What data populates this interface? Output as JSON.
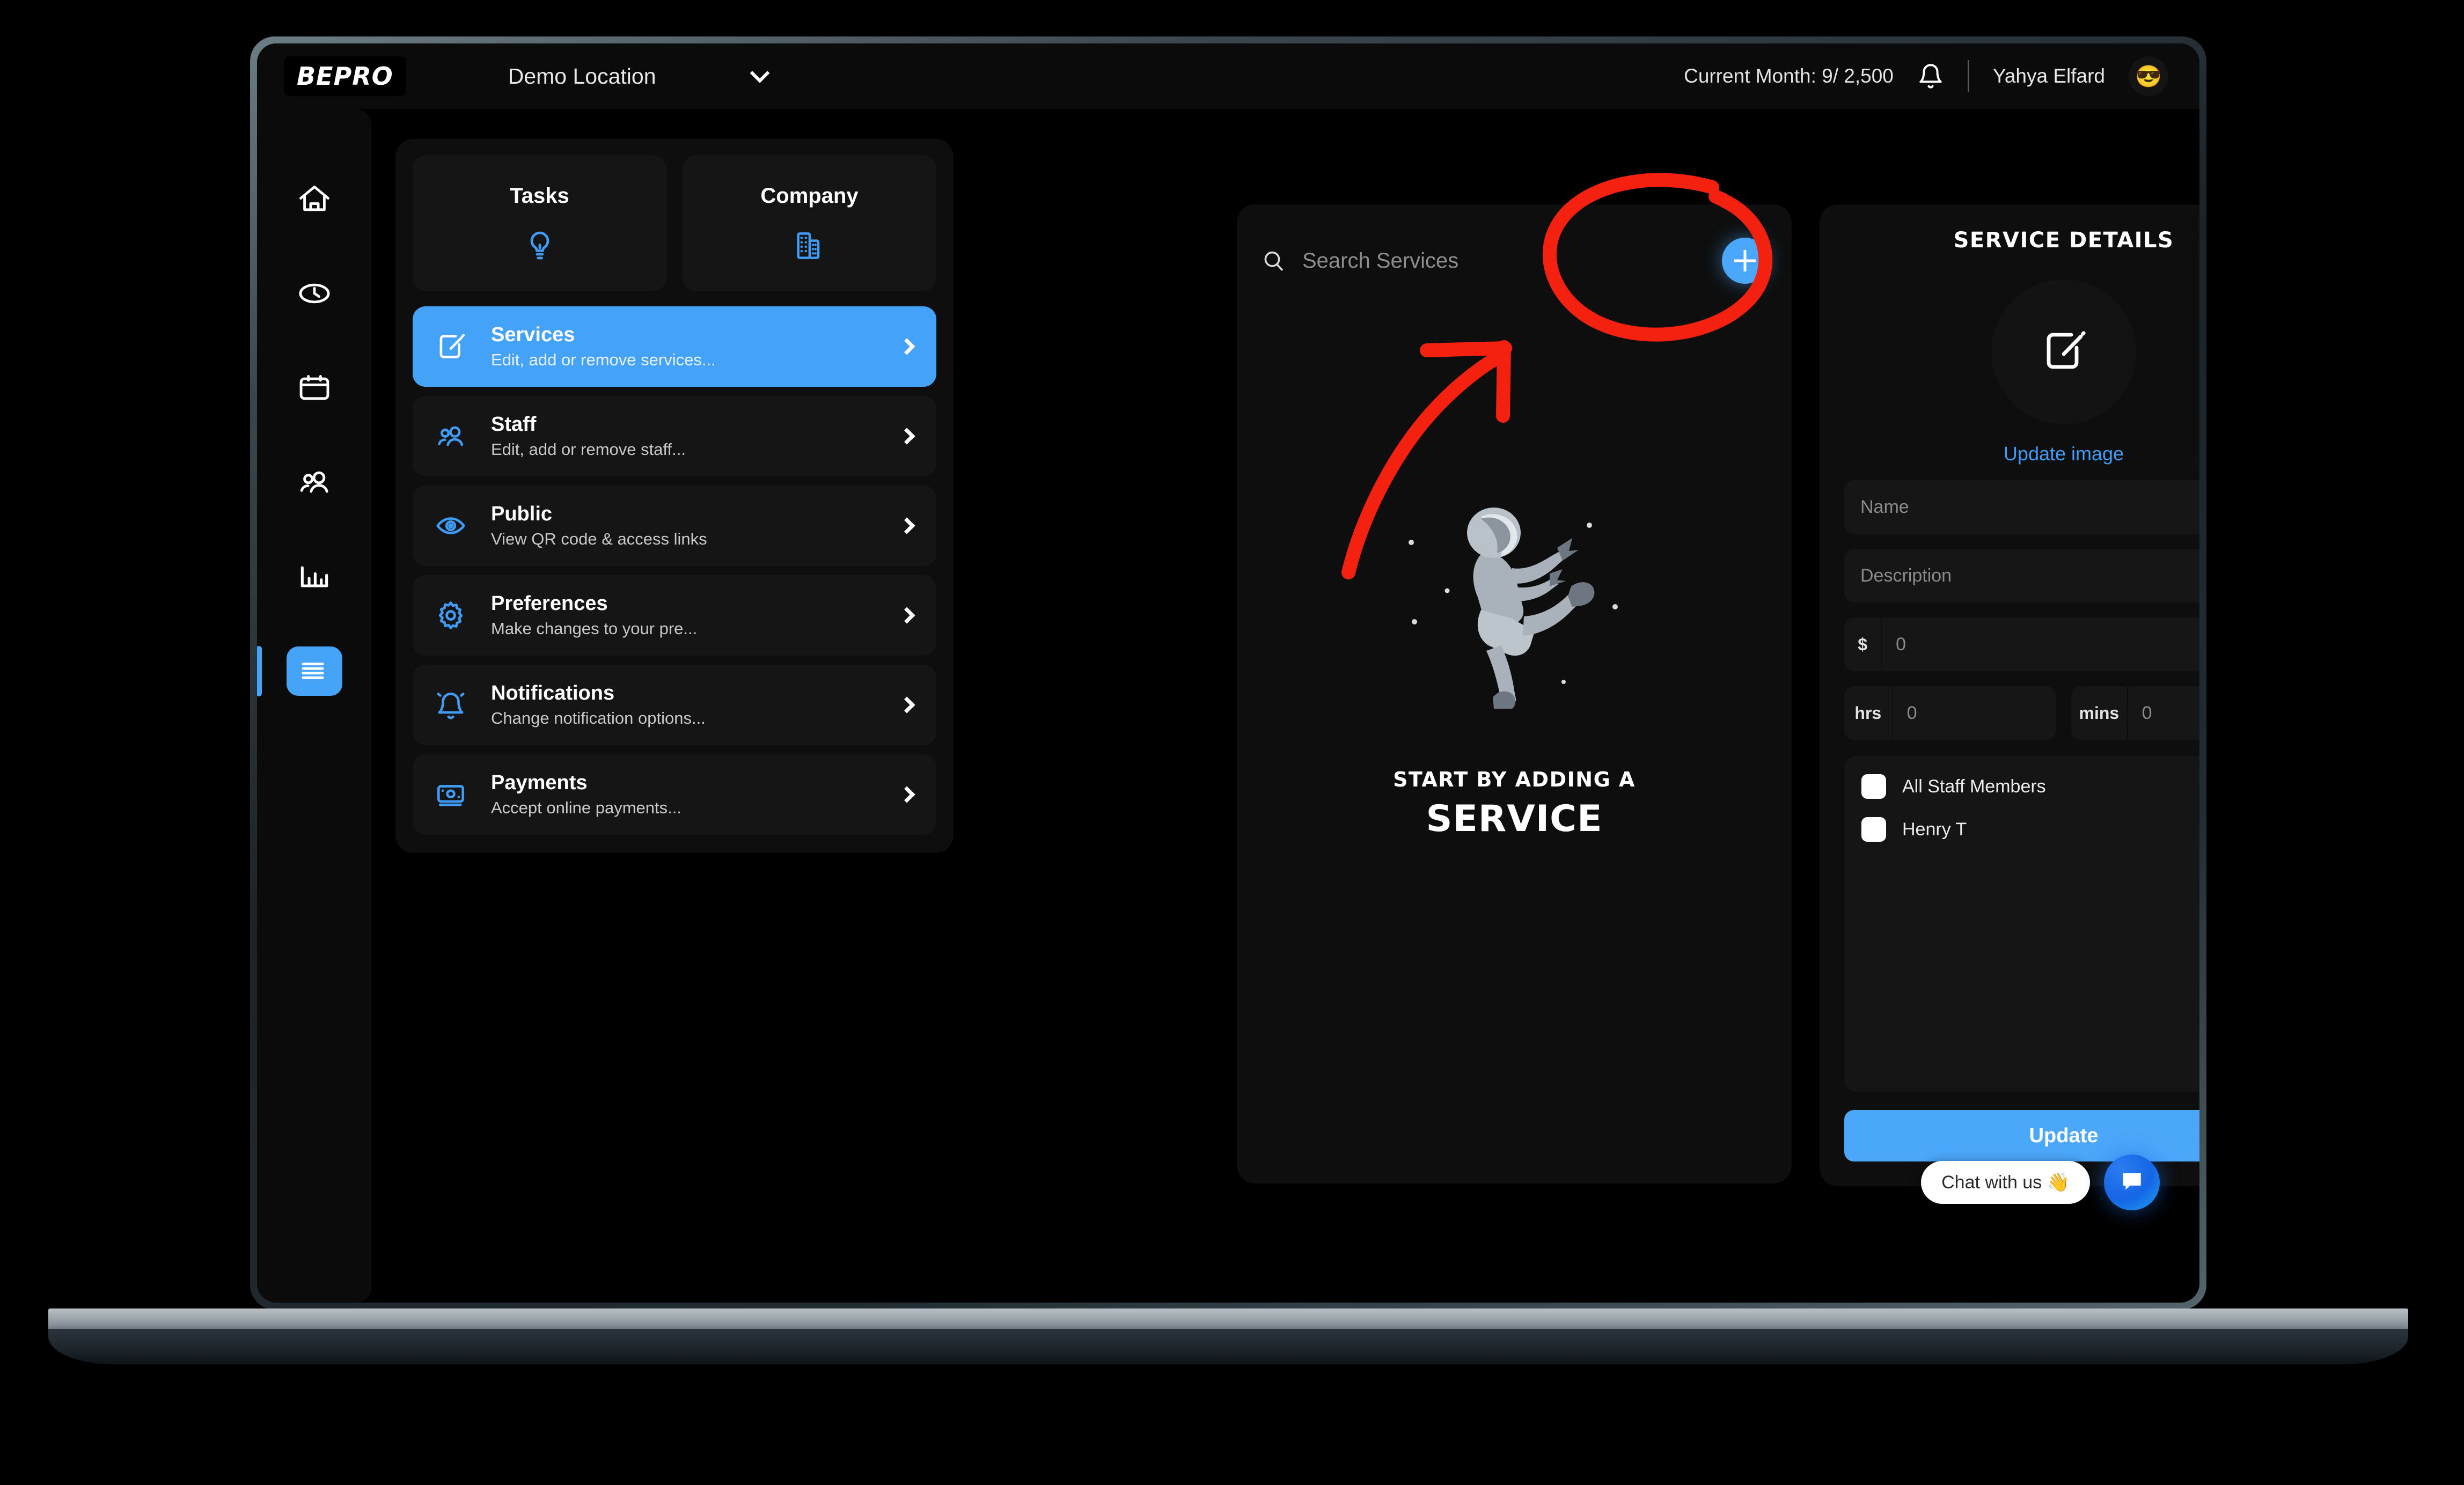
{
  "app": {
    "logo": "BEPRO",
    "accent": "#4ba7f9",
    "panel_bg": "#0e0e0e",
    "annotation_color": "#f42110"
  },
  "topbar": {
    "location": "Demo Location",
    "location_chevron": "chevron-down-icon",
    "month_counter": "Current Month: 9/ 2,500",
    "notification_icon": "bell-icon",
    "user_name": "Yahya Elfard",
    "avatar_glyph": "😎"
  },
  "rail": {
    "items": [
      {
        "name": "home",
        "icon": "home-icon",
        "active": false
      },
      {
        "name": "time",
        "icon": "clock-icon",
        "active": false
      },
      {
        "name": "calendar",
        "icon": "calendar-icon",
        "active": false
      },
      {
        "name": "customers",
        "icon": "people-icon",
        "active": false
      },
      {
        "name": "reports",
        "icon": "bar-chart-icon",
        "active": false
      },
      {
        "name": "settings",
        "icon": "list-menu-icon",
        "active": true
      }
    ]
  },
  "settings": {
    "segments": [
      {
        "label": "Tasks",
        "icon": "lightbulb-icon"
      },
      {
        "label": "Company",
        "icon": "building-icon"
      }
    ],
    "menu": [
      {
        "title": "Services",
        "sub": "Edit, add or remove services...",
        "icon": "edit-square-icon",
        "active": true
      },
      {
        "title": "Staff",
        "sub": "Edit, add or remove staff...",
        "icon": "people-icon",
        "active": false
      },
      {
        "title": "Public",
        "sub": "View QR code & access links",
        "icon": "eye-icon",
        "active": false
      },
      {
        "title": "Preferences",
        "sub": "Make changes to your pre...",
        "icon": "gear-icon",
        "active": false
      },
      {
        "title": "Notifications",
        "sub": "Change notification options...",
        "icon": "bell-ring-icon",
        "active": false
      },
      {
        "title": "Payments",
        "sub": "Accept online payments...",
        "icon": "payment-card-icon",
        "active": false
      }
    ]
  },
  "services_panel": {
    "search_placeholder": "Search Services",
    "search_value": "",
    "search_icon": "search-icon",
    "add_button_icon": "plus-icon",
    "empty_illustration": "astronaut-illustration",
    "empty_line1": "START BY ADDING A",
    "empty_line2": "SERVICE"
  },
  "service_details": {
    "title": "SERVICE DETAILS",
    "collapse_icon": "chevron-down-icon",
    "image_placeholder_icon": "edit-square-icon",
    "update_image_label": "Update image",
    "fields": {
      "name_placeholder": "Name",
      "name_value": "",
      "description_placeholder": "Description",
      "description_value": "",
      "price_prefix": "$",
      "price_value": "0",
      "hours_prefix": "hrs",
      "hours_value": "0",
      "minutes_prefix": "mins",
      "minutes_value": "0"
    },
    "staff": [
      {
        "label": "All Staff Members",
        "checked": false
      },
      {
        "label": "Henry T",
        "checked": false
      }
    ],
    "update_label": "Update"
  },
  "chat": {
    "pill_label": "Chat with us 👋",
    "fab_icon": "chat-bubble-icon"
  }
}
